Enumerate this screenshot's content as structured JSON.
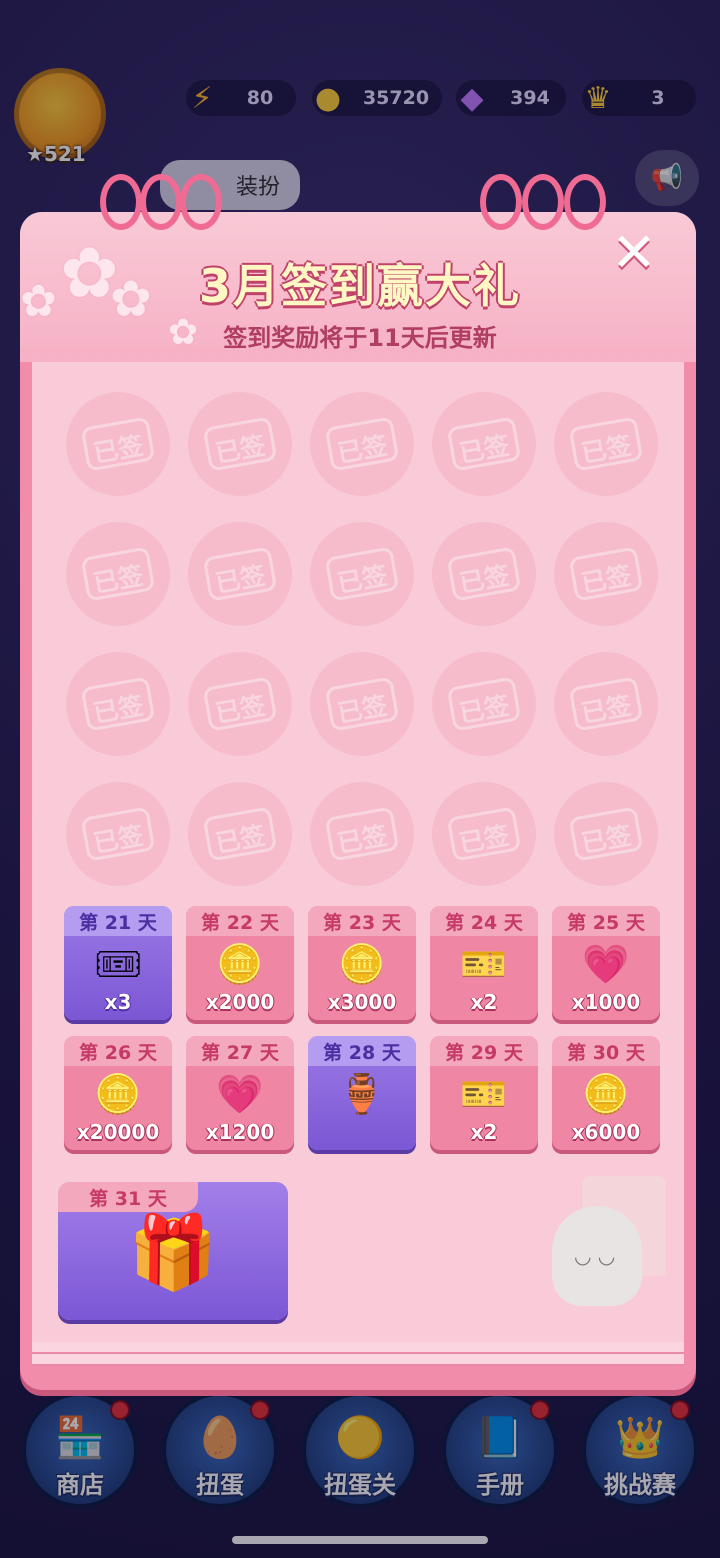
{
  "hud": {
    "level": "521",
    "energy": "80",
    "coins": "35720",
    "gems": "394",
    "crowns": "3",
    "bg_tab_label": "装扮",
    "icons": {
      "energy": "lightning-icon",
      "coins": "coin-icon",
      "gems": "gem-icon",
      "crowns": "crown-icon",
      "announce": "megaphone-icon"
    }
  },
  "dialog": {
    "title": "3月签到赢大礼",
    "subtitle": "签到奖励将于11天后更新",
    "close_label": "✕",
    "signed_label": "已签",
    "signed_count": 20,
    "rewards": [
      {
        "day": "第 21 天",
        "amount": "x3",
        "icon": "🎟",
        "style": "purple"
      },
      {
        "day": "第 22 天",
        "amount": "x2000",
        "icon": "🪙",
        "style": "pink"
      },
      {
        "day": "第 23 天",
        "amount": "x3000",
        "icon": "🪙",
        "style": "pink"
      },
      {
        "day": "第 24 天",
        "amount": "x2",
        "icon": "🎫",
        "style": "pink"
      },
      {
        "day": "第 25 天",
        "amount": "x1000",
        "icon": "💗",
        "style": "pink"
      },
      {
        "day": "第 26 天",
        "amount": "x20000",
        "icon": "🪙",
        "style": "pink"
      },
      {
        "day": "第 27 天",
        "amount": "x1200",
        "icon": "💗",
        "style": "pink"
      },
      {
        "day": "第 28 天",
        "amount": "",
        "icon": "🏺",
        "style": "purple"
      },
      {
        "day": "第 29 天",
        "amount": "x2",
        "icon": "🎫",
        "style": "pink"
      },
      {
        "day": "第 30 天",
        "amount": "x6000",
        "icon": "🪙",
        "style": "pink"
      }
    ],
    "final_reward": {
      "day": "第 31 天",
      "icon": "🎁"
    }
  },
  "nav": [
    {
      "label": "商店",
      "icon": "🏪",
      "badge": true
    },
    {
      "label": "扭蛋",
      "icon": "🥚",
      "badge": true
    },
    {
      "label": "扭蛋关",
      "icon": "🟡",
      "badge": false
    },
    {
      "label": "手册",
      "icon": "📘",
      "badge": true
    },
    {
      "label": "挑战赛",
      "icon": "👑",
      "badge": true
    }
  ],
  "colors": {
    "accent_pink": "#f18cab",
    "title_yellow": "#fff8c4",
    "card_purple": "#7b57d4"
  }
}
